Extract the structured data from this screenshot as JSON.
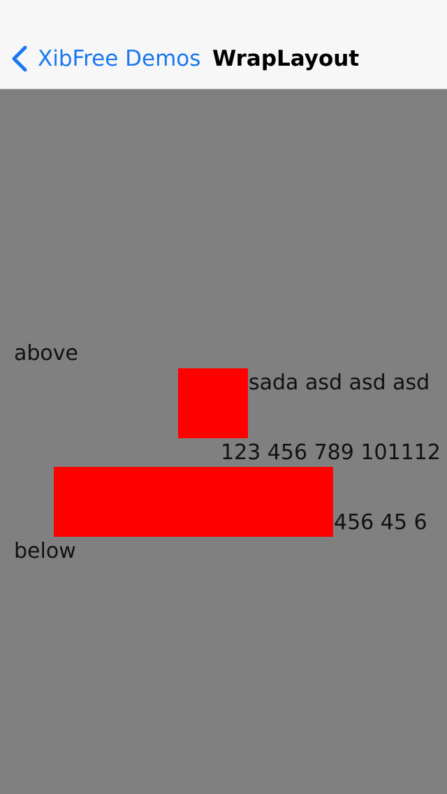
{
  "navbar": {
    "back_label": "XibFree Demos",
    "title": "WrapLayout",
    "back_icon": "chevron-left-icon"
  },
  "content": {
    "above_label": "above",
    "row1_text": "sada asd asd asd",
    "row2_text": "123 456 789 101112",
    "row3_text": "456 45 6",
    "below_label": "below"
  },
  "colors": {
    "accent": "#1a78f0",
    "background": "#808080",
    "box": "#ff0000"
  }
}
